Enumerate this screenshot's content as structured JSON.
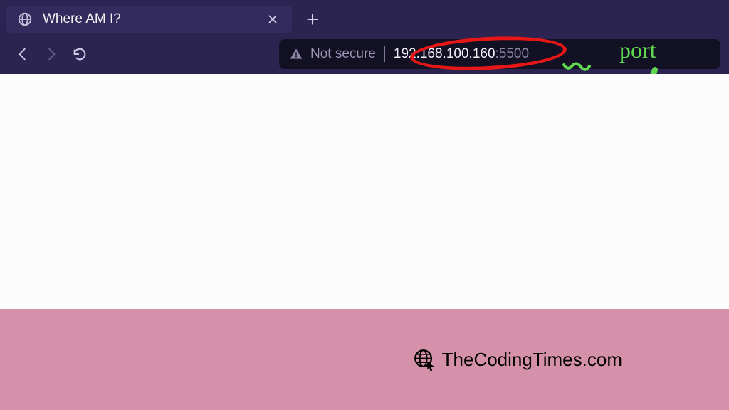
{
  "tab": {
    "title": "Where AM I?"
  },
  "toolbar": {
    "back_enabled": true,
    "forward_enabled": false
  },
  "address": {
    "security_label": "Not secure",
    "ip": "192.168.100.160",
    "port": "5500"
  },
  "annotations": {
    "port_label": "port"
  },
  "footer": {
    "brand_text": "TheCodingTimes.com"
  }
}
